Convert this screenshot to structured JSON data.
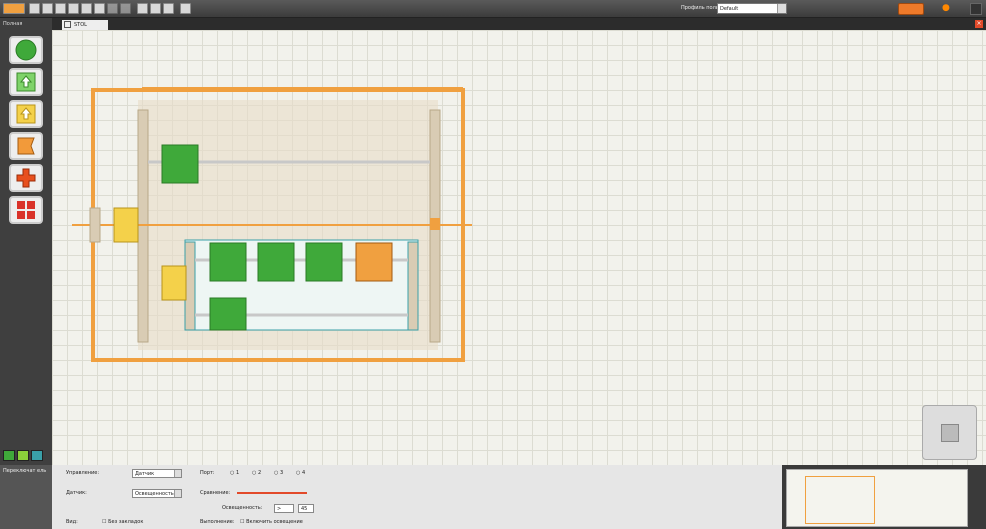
{
  "toolbar": {
    "profile_label": "Профиль пользователя:",
    "profile_value": "Default"
  },
  "palette": {
    "title": "Полная"
  },
  "tab": {
    "name": "STOL"
  },
  "config": {
    "title": "Переключат ель",
    "control_label": "Управление:",
    "control_value": "Датчик",
    "sensor_label": "Датчик:",
    "sensor_value": "Освещенность",
    "port_label": "Порт:",
    "ports": [
      "1",
      "2",
      "3",
      "4"
    ],
    "compare_label": "Сравнение:",
    "brightness_label": "Освещенность:",
    "compare_op": ">",
    "compare_value": "45",
    "view_label": "Вид:",
    "no_tabs_label": "Без закладок",
    "function_label": "Выполнение:",
    "light_on_label": "Включить освещение"
  },
  "colors": {
    "accent": "#f0a040",
    "beam": "#e8dcc8",
    "green": "#3fa93a"
  }
}
